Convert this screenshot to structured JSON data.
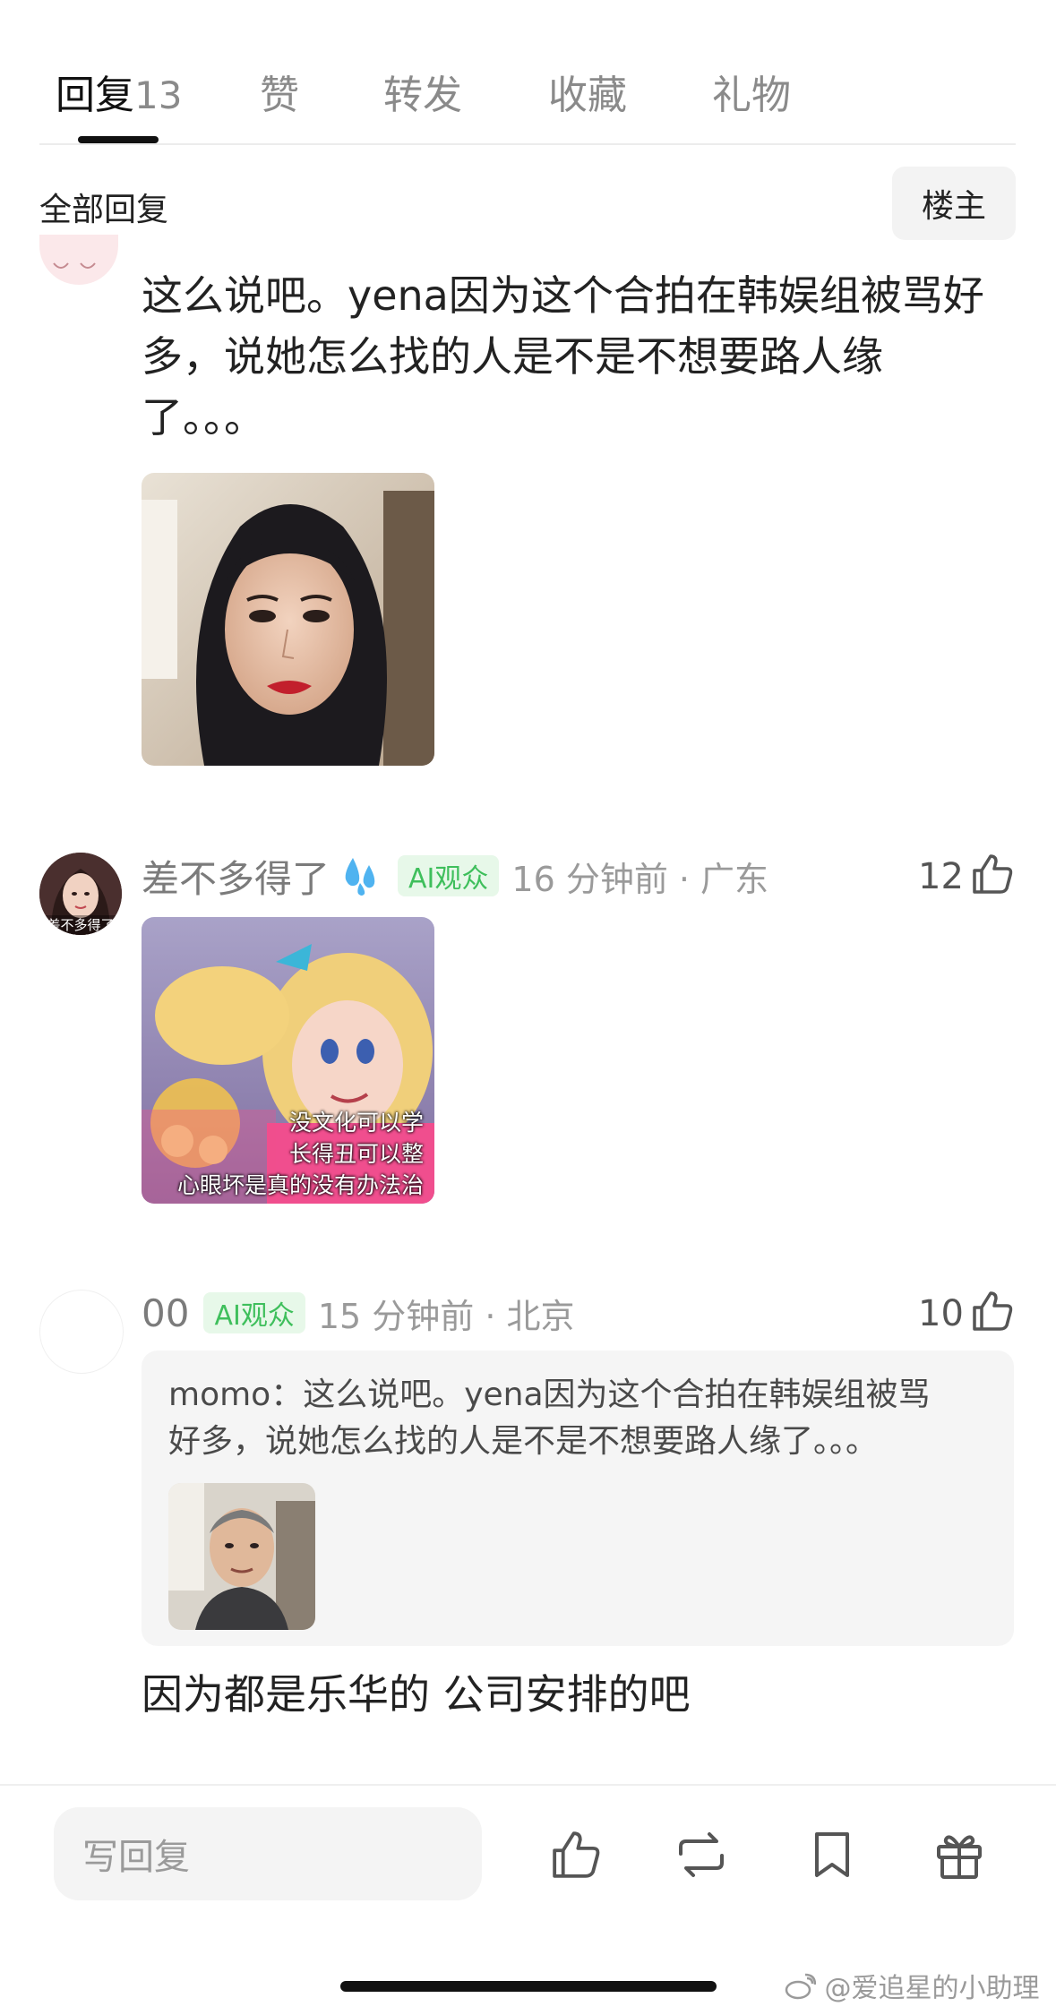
{
  "tabs": [
    {
      "label": "回复",
      "count": "13"
    },
    {
      "label": "赞"
    },
    {
      "label": "转发"
    },
    {
      "label": "收藏"
    },
    {
      "label": "礼物"
    }
  ],
  "filter": {
    "label": "全部回复",
    "owner_button": "楼主"
  },
  "replies": [
    {
      "text_lines": [
        "这么说吧。yena因为这个合拍在韩娱组被骂好",
        "多，说她怎么找的人是不是不想要路人缘",
        "了。。。"
      ]
    },
    {
      "username": "差不多得了",
      "badge": "AI观众",
      "meta": "16 分钟前 · 广东",
      "likes": "12",
      "avatar_caption": "差不多得了",
      "image_caption_lines": [
        "没文化可以学",
        "长得丑可以整",
        "心眼坏是真的没有办法治"
      ]
    },
    {
      "username": "00",
      "badge": "AI观众",
      "meta": "15 分钟前 · 北京",
      "likes": "10",
      "quote_lines": [
        "momo：这么说吧。yena因为这个合拍在韩娱组被骂",
        "好多，说她怎么找的人是不是不想要路人缘了。。。"
      ],
      "text": "因为都是乐华的 公司安排的吧"
    }
  ],
  "bottom_bar": {
    "compose_placeholder": "写回复"
  },
  "watermark": "@爱追星的小助理",
  "icons": [
    "water-drop-icon",
    "thumb-up-icon",
    "repost-icon",
    "bookmark-icon",
    "gift-icon",
    "weibo-logo-icon"
  ]
}
